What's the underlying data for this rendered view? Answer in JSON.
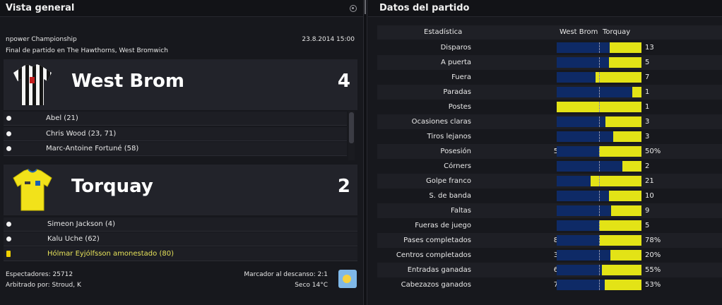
{
  "left_panel": {
    "title": "Vista general",
    "competition": "npower Championship",
    "datetime": "23.8.2014 15:00",
    "venue_line": "Final de partido en The Hawthorns, West Bromwich",
    "home": {
      "name": "West Brom",
      "score": "4",
      "kit_colors": [
        "#ffffff",
        "#111111"
      ],
      "events": [
        {
          "icon": "ball-icon",
          "text": "Abel (21)"
        },
        {
          "icon": "ball-icon",
          "text": "Chris Wood (23, 71)"
        },
        {
          "icon": "ball-icon",
          "text": "Marc-Antoine Fortuné (58)"
        }
      ]
    },
    "away": {
      "name": "Torquay",
      "score": "2",
      "kit_colors": [
        "#f2e21a",
        "#1a5fb4"
      ],
      "events": [
        {
          "icon": "ball-icon",
          "text": "Simeon Jackson (4)"
        },
        {
          "icon": "ball-icon",
          "text": "Kalu Uche (62)"
        },
        {
          "icon": "yellow-card-icon",
          "text": "Hólmar Eyjólfsson amonestado (80)"
        }
      ]
    },
    "footer": {
      "attendance": "Espectadores: 25712",
      "referee": "Arbitrado por: Stroud, K",
      "halftime": "Marcador al descanso: 2:1",
      "weather": "Seco 14°C",
      "weather_icon": "sunny-weather-icon"
    }
  },
  "right_panel": {
    "title": "Datos del partido",
    "header": {
      "stat": "Estadística",
      "home": "West Brom",
      "away": "Torquay"
    },
    "colors": {
      "home_bar": "#0e2a66",
      "away_bar": "#e3e316"
    },
    "stats": [
      {
        "name": "Disparos",
        "home": "22",
        "away": "13",
        "home_value": 22,
        "away_value": 13
      },
      {
        "name": "A puerta",
        "home": "8",
        "away": "5",
        "home_value": 8,
        "away_value": 5
      },
      {
        "name": "Fuera",
        "home": "6",
        "away": "7",
        "home_value": 6,
        "away_value": 7
      },
      {
        "name": "Paradas",
        "home": "8",
        "away": "1",
        "home_value": 8,
        "away_value": 1
      },
      {
        "name": "Postes",
        "home": "0",
        "away": "1",
        "home_value": 0,
        "away_value": 1
      },
      {
        "name": "Ocasiones claras",
        "home": "4",
        "away": "3",
        "home_value": 4,
        "away_value": 3
      },
      {
        "name": "Tiros lejanos",
        "home": "6",
        "away": "3",
        "home_value": 6,
        "away_value": 3
      },
      {
        "name": "Posesión",
        "home": "50%",
        "away": "50%",
        "home_value": 50,
        "away_value": 50
      },
      {
        "name": "Córners",
        "home": "7",
        "away": "2",
        "home_value": 7,
        "away_value": 2
      },
      {
        "name": "Golpe franco",
        "home": "14",
        "away": "21",
        "home_value": 14,
        "away_value": 21
      },
      {
        "name": "S. de banda",
        "home": "16",
        "away": "10",
        "home_value": 16,
        "away_value": 10
      },
      {
        "name": "Faltas",
        "home": "16",
        "away": "9",
        "home_value": 16,
        "away_value": 9
      },
      {
        "name": "Fueras de juego",
        "home": "5",
        "away": "5",
        "home_value": 5,
        "away_value": 5
      },
      {
        "name": "Pases completados",
        "home": "82%",
        "away": "78%",
        "home_value": 82,
        "away_value": 78
      },
      {
        "name": "Centros completados",
        "home": "34%",
        "away": "20%",
        "home_value": 34,
        "away_value": 20
      },
      {
        "name": "Entradas ganadas",
        "home": "63%",
        "away": "55%",
        "home_value": 63,
        "away_value": 55
      },
      {
        "name": "Cabezazos ganados",
        "home": "70%",
        "away": "53%",
        "home_value": 70,
        "away_value": 53
      }
    ]
  }
}
